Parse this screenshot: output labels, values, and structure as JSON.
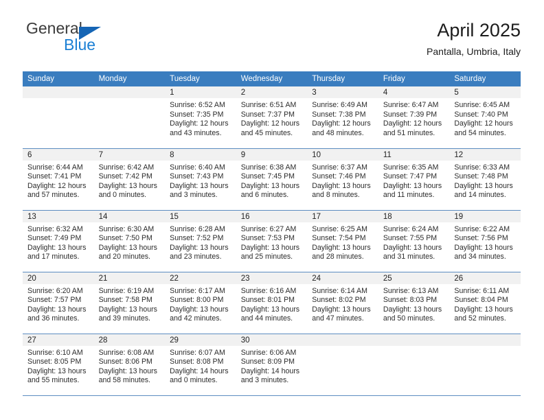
{
  "brand": {
    "name_top": "General",
    "name_bottom": "Blue",
    "triangle_color": "#1565b5",
    "blue_color": "#1a7fd4"
  },
  "header": {
    "title": "April 2025",
    "subtitle": "Pantalla, Umbria, Italy"
  },
  "theme": {
    "header_row_bg": "#3a7dbf",
    "daynum_band_bg": "#f1f1f1",
    "row_separator": "#5b8cc0"
  },
  "weekdays": [
    "Sunday",
    "Monday",
    "Tuesday",
    "Wednesday",
    "Thursday",
    "Friday",
    "Saturday"
  ],
  "weeks": [
    [
      {
        "day": "",
        "sunrise": "",
        "sunset": "",
        "daylight_1": "",
        "daylight_2": ""
      },
      {
        "day": "",
        "sunrise": "",
        "sunset": "",
        "daylight_1": "",
        "daylight_2": ""
      },
      {
        "day": "1",
        "sunrise": "Sunrise: 6:52 AM",
        "sunset": "Sunset: 7:35 PM",
        "daylight_1": "Daylight: 12 hours",
        "daylight_2": "and 43 minutes."
      },
      {
        "day": "2",
        "sunrise": "Sunrise: 6:51 AM",
        "sunset": "Sunset: 7:37 PM",
        "daylight_1": "Daylight: 12 hours",
        "daylight_2": "and 45 minutes."
      },
      {
        "day": "3",
        "sunrise": "Sunrise: 6:49 AM",
        "sunset": "Sunset: 7:38 PM",
        "daylight_1": "Daylight: 12 hours",
        "daylight_2": "and 48 minutes."
      },
      {
        "day": "4",
        "sunrise": "Sunrise: 6:47 AM",
        "sunset": "Sunset: 7:39 PM",
        "daylight_1": "Daylight: 12 hours",
        "daylight_2": "and 51 minutes."
      },
      {
        "day": "5",
        "sunrise": "Sunrise: 6:45 AM",
        "sunset": "Sunset: 7:40 PM",
        "daylight_1": "Daylight: 12 hours",
        "daylight_2": "and 54 minutes."
      }
    ],
    [
      {
        "day": "6",
        "sunrise": "Sunrise: 6:44 AM",
        "sunset": "Sunset: 7:41 PM",
        "daylight_1": "Daylight: 12 hours",
        "daylight_2": "and 57 minutes."
      },
      {
        "day": "7",
        "sunrise": "Sunrise: 6:42 AM",
        "sunset": "Sunset: 7:42 PM",
        "daylight_1": "Daylight: 13 hours",
        "daylight_2": "and 0 minutes."
      },
      {
        "day": "8",
        "sunrise": "Sunrise: 6:40 AM",
        "sunset": "Sunset: 7:43 PM",
        "daylight_1": "Daylight: 13 hours",
        "daylight_2": "and 3 minutes."
      },
      {
        "day": "9",
        "sunrise": "Sunrise: 6:38 AM",
        "sunset": "Sunset: 7:45 PM",
        "daylight_1": "Daylight: 13 hours",
        "daylight_2": "and 6 minutes."
      },
      {
        "day": "10",
        "sunrise": "Sunrise: 6:37 AM",
        "sunset": "Sunset: 7:46 PM",
        "daylight_1": "Daylight: 13 hours",
        "daylight_2": "and 8 minutes."
      },
      {
        "day": "11",
        "sunrise": "Sunrise: 6:35 AM",
        "sunset": "Sunset: 7:47 PM",
        "daylight_1": "Daylight: 13 hours",
        "daylight_2": "and 11 minutes."
      },
      {
        "day": "12",
        "sunrise": "Sunrise: 6:33 AM",
        "sunset": "Sunset: 7:48 PM",
        "daylight_1": "Daylight: 13 hours",
        "daylight_2": "and 14 minutes."
      }
    ],
    [
      {
        "day": "13",
        "sunrise": "Sunrise: 6:32 AM",
        "sunset": "Sunset: 7:49 PM",
        "daylight_1": "Daylight: 13 hours",
        "daylight_2": "and 17 minutes."
      },
      {
        "day": "14",
        "sunrise": "Sunrise: 6:30 AM",
        "sunset": "Sunset: 7:50 PM",
        "daylight_1": "Daylight: 13 hours",
        "daylight_2": "and 20 minutes."
      },
      {
        "day": "15",
        "sunrise": "Sunrise: 6:28 AM",
        "sunset": "Sunset: 7:52 PM",
        "daylight_1": "Daylight: 13 hours",
        "daylight_2": "and 23 minutes."
      },
      {
        "day": "16",
        "sunrise": "Sunrise: 6:27 AM",
        "sunset": "Sunset: 7:53 PM",
        "daylight_1": "Daylight: 13 hours",
        "daylight_2": "and 25 minutes."
      },
      {
        "day": "17",
        "sunrise": "Sunrise: 6:25 AM",
        "sunset": "Sunset: 7:54 PM",
        "daylight_1": "Daylight: 13 hours",
        "daylight_2": "and 28 minutes."
      },
      {
        "day": "18",
        "sunrise": "Sunrise: 6:24 AM",
        "sunset": "Sunset: 7:55 PM",
        "daylight_1": "Daylight: 13 hours",
        "daylight_2": "and 31 minutes."
      },
      {
        "day": "19",
        "sunrise": "Sunrise: 6:22 AM",
        "sunset": "Sunset: 7:56 PM",
        "daylight_1": "Daylight: 13 hours",
        "daylight_2": "and 34 minutes."
      }
    ],
    [
      {
        "day": "20",
        "sunrise": "Sunrise: 6:20 AM",
        "sunset": "Sunset: 7:57 PM",
        "daylight_1": "Daylight: 13 hours",
        "daylight_2": "and 36 minutes."
      },
      {
        "day": "21",
        "sunrise": "Sunrise: 6:19 AM",
        "sunset": "Sunset: 7:58 PM",
        "daylight_1": "Daylight: 13 hours",
        "daylight_2": "and 39 minutes."
      },
      {
        "day": "22",
        "sunrise": "Sunrise: 6:17 AM",
        "sunset": "Sunset: 8:00 PM",
        "daylight_1": "Daylight: 13 hours",
        "daylight_2": "and 42 minutes."
      },
      {
        "day": "23",
        "sunrise": "Sunrise: 6:16 AM",
        "sunset": "Sunset: 8:01 PM",
        "daylight_1": "Daylight: 13 hours",
        "daylight_2": "and 44 minutes."
      },
      {
        "day": "24",
        "sunrise": "Sunrise: 6:14 AM",
        "sunset": "Sunset: 8:02 PM",
        "daylight_1": "Daylight: 13 hours",
        "daylight_2": "and 47 minutes."
      },
      {
        "day": "25",
        "sunrise": "Sunrise: 6:13 AM",
        "sunset": "Sunset: 8:03 PM",
        "daylight_1": "Daylight: 13 hours",
        "daylight_2": "and 50 minutes."
      },
      {
        "day": "26",
        "sunrise": "Sunrise: 6:11 AM",
        "sunset": "Sunset: 8:04 PM",
        "daylight_1": "Daylight: 13 hours",
        "daylight_2": "and 52 minutes."
      }
    ],
    [
      {
        "day": "27",
        "sunrise": "Sunrise: 6:10 AM",
        "sunset": "Sunset: 8:05 PM",
        "daylight_1": "Daylight: 13 hours",
        "daylight_2": "and 55 minutes."
      },
      {
        "day": "28",
        "sunrise": "Sunrise: 6:08 AM",
        "sunset": "Sunset: 8:06 PM",
        "daylight_1": "Daylight: 13 hours",
        "daylight_2": "and 58 minutes."
      },
      {
        "day": "29",
        "sunrise": "Sunrise: 6:07 AM",
        "sunset": "Sunset: 8:08 PM",
        "daylight_1": "Daylight: 14 hours",
        "daylight_2": "and 0 minutes."
      },
      {
        "day": "30",
        "sunrise": "Sunrise: 6:06 AM",
        "sunset": "Sunset: 8:09 PM",
        "daylight_1": "Daylight: 14 hours",
        "daylight_2": "and 3 minutes."
      },
      {
        "day": "",
        "sunrise": "",
        "sunset": "",
        "daylight_1": "",
        "daylight_2": ""
      },
      {
        "day": "",
        "sunrise": "",
        "sunset": "",
        "daylight_1": "",
        "daylight_2": ""
      },
      {
        "day": "",
        "sunrise": "",
        "sunset": "",
        "daylight_1": "",
        "daylight_2": ""
      }
    ]
  ]
}
